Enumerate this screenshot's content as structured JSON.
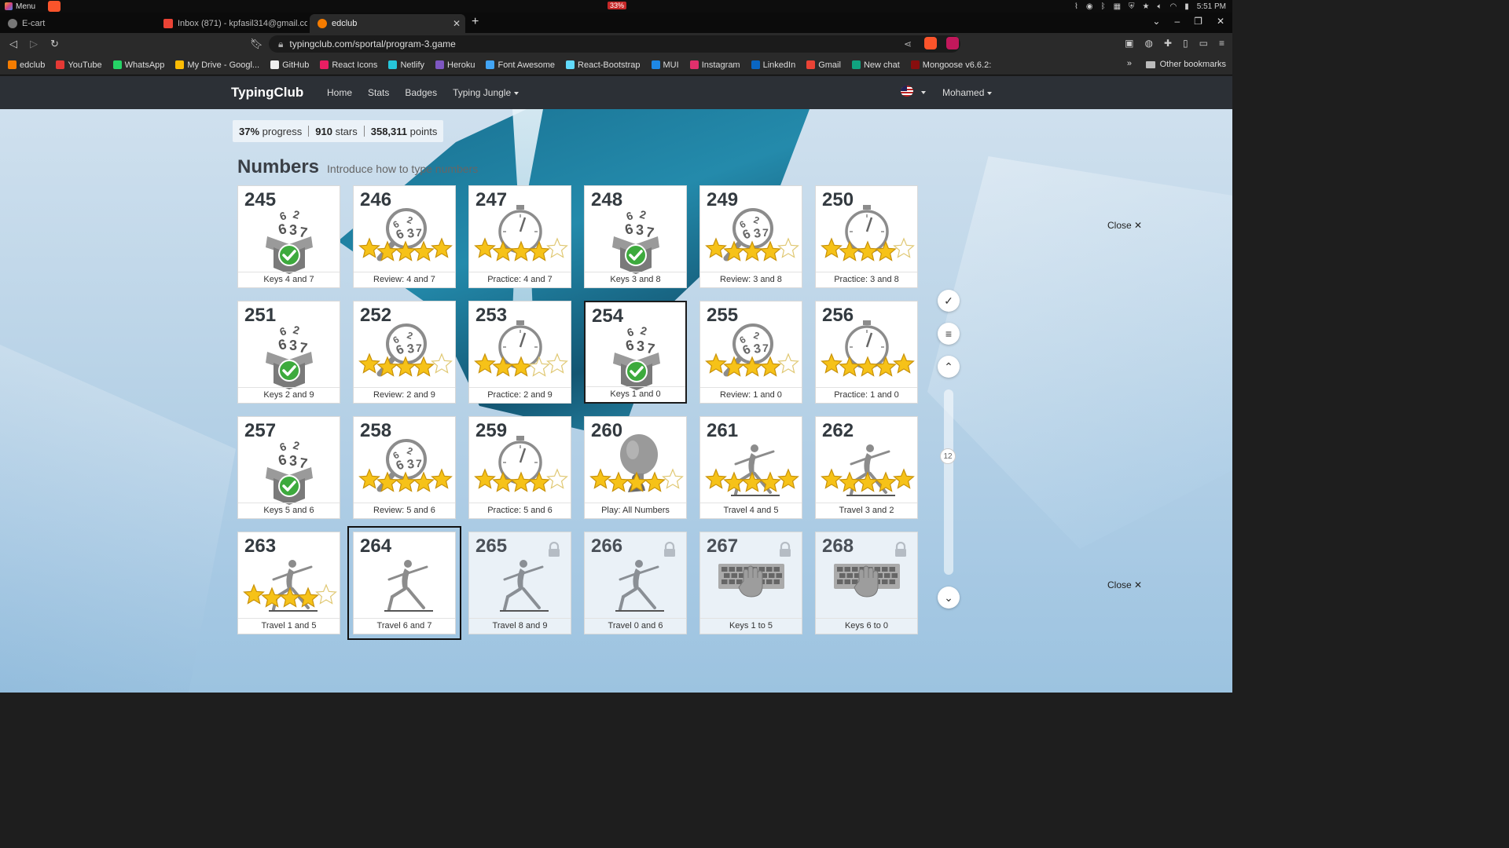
{
  "os": {
    "menu_label": "Menu",
    "battery": "33%",
    "time": "5:51 PM"
  },
  "tabs": [
    {
      "label": "E-cart"
    },
    {
      "label": "Inbox (871) - kpfasil314@gmail.co"
    },
    {
      "label": "edclub"
    }
  ],
  "address": {
    "url": "typingclub.com/sportal/program-3.game"
  },
  "bookmarks": [
    {
      "label": "edclub",
      "color": "#f57c00"
    },
    {
      "label": "YouTube",
      "color": "#e53935"
    },
    {
      "label": "WhatsApp",
      "color": "#25d366"
    },
    {
      "label": "My Drive - Googl...",
      "color": "#fbbc04"
    },
    {
      "label": "GitHub",
      "color": "#eeeeee"
    },
    {
      "label": "React Icons",
      "color": "#e91e63"
    },
    {
      "label": "Netlify",
      "color": "#26c6da"
    },
    {
      "label": "Heroku",
      "color": "#7e57c2"
    },
    {
      "label": "Font Awesome",
      "color": "#42a5f5"
    },
    {
      "label": "React-Bootstrap",
      "color": "#61dafb"
    },
    {
      "label": "MUI",
      "color": "#1e88e5"
    },
    {
      "label": "Instagram",
      "color": "#e1306c"
    },
    {
      "label": "LinkedIn",
      "color": "#0a66c2"
    },
    {
      "label": "Gmail",
      "color": "#ea4335"
    },
    {
      "label": "New chat",
      "color": "#10a37f"
    },
    {
      "label": "Mongoose v6.6.2:",
      "color": "#880e0e"
    }
  ],
  "other_bookmarks": "Other bookmarks",
  "site": {
    "brand": "TypingClub",
    "nav": {
      "home": "Home",
      "stats": "Stats",
      "badges": "Badges",
      "jungle": "Typing Jungle"
    },
    "user": "Mohamed"
  },
  "progress": {
    "percent": "37%",
    "percent_label": "progress",
    "stars": "910",
    "stars_label": "stars",
    "points": "358,311",
    "points_label": "points"
  },
  "section": {
    "title": "Numbers",
    "description": "Introduce how to type numbers"
  },
  "lessons": [
    {
      "num": "245",
      "label": "Keys 4 and 7",
      "art": "box",
      "done": true,
      "stars": 0
    },
    {
      "num": "246",
      "label": "Review: 4 and 7",
      "art": "magnifier",
      "stars": 5
    },
    {
      "num": "247",
      "label": "Practice: 4 and 7",
      "art": "stopwatch",
      "stars": 4
    },
    {
      "num": "248",
      "label": "Keys 3 and 8",
      "art": "box",
      "done": true,
      "stars": 0
    },
    {
      "num": "249",
      "label": "Review: 3 and 8",
      "art": "magnifier",
      "stars": 4
    },
    {
      "num": "250",
      "label": "Practice: 3 and 8",
      "art": "stopwatch",
      "stars": 4
    },
    {
      "num": "251",
      "label": "Keys 2 and 9",
      "art": "box",
      "done": true,
      "stars": 0
    },
    {
      "num": "252",
      "label": "Review: 2 and 9",
      "art": "magnifier",
      "stars": 4
    },
    {
      "num": "253",
      "label": "Practice: 2 and 9",
      "art": "stopwatch",
      "stars": 3
    },
    {
      "num": "254",
      "label": "Keys 1 and 0",
      "art": "box",
      "done": true,
      "stars": 0
    },
    {
      "num": "255",
      "label": "Review: 1 and 0",
      "art": "magnifier",
      "stars": 4
    },
    {
      "num": "256",
      "label": "Practice: 1 and 0",
      "art": "stopwatch",
      "stars": 5
    },
    {
      "num": "257",
      "label": "Keys 5 and 6",
      "art": "box",
      "done": true,
      "stars": 0
    },
    {
      "num": "258",
      "label": "Review: 5 and 6",
      "art": "magnifier",
      "stars": 5
    },
    {
      "num": "259",
      "label": "Practice: 5 and 6",
      "art": "stopwatch",
      "stars": 4
    },
    {
      "num": "260",
      "label": "Play: All Numbers",
      "art": "balloon",
      "stars": 4
    },
    {
      "num": "261",
      "label": "Travel 4 and 5",
      "art": "runner",
      "stars": 5
    },
    {
      "num": "262",
      "label": "Travel 3 and 2",
      "art": "runner",
      "stars": 5
    },
    {
      "num": "263",
      "label": "Travel 1 and 5",
      "art": "runner",
      "stars": 4
    },
    {
      "num": "264",
      "label": "Travel 6 and 7",
      "art": "runner",
      "stars": 0,
      "current": true
    },
    {
      "num": "265",
      "label": "Travel 8 and 9",
      "art": "runner",
      "stars": 0,
      "locked": true
    },
    {
      "num": "266",
      "label": "Travel 0 and 6",
      "art": "runner",
      "stars": 0,
      "locked": true
    },
    {
      "num": "267",
      "label": "Keys 1 to 5",
      "art": "keyboard",
      "stars": 0,
      "locked": true
    },
    {
      "num": "268",
      "label": "Keys 6 to 0",
      "art": "keyboard",
      "stars": 0,
      "locked": true
    }
  ],
  "side": {
    "close_label": "Close ✕",
    "page_number": "12"
  }
}
